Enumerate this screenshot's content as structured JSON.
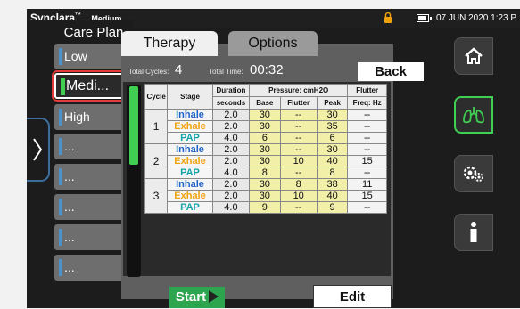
{
  "status": {
    "brand": "Synclara",
    "brand_tm": "™",
    "mode": "Medium",
    "datetime": "07 JUN 2020  1:23 P"
  },
  "care_plan": {
    "title": "Care Plan",
    "items": [
      {
        "label": "Low"
      },
      {
        "label": "Medi..."
      },
      {
        "label": "High"
      },
      {
        "label": "..."
      },
      {
        "label": "..."
      },
      {
        "label": "..."
      },
      {
        "label": "..."
      },
      {
        "label": "..."
      }
    ]
  },
  "tabs": {
    "therapy": "Therapy",
    "options": "Options"
  },
  "summary": {
    "cycles_label": "Total Cycles:",
    "cycles_value": "4",
    "time_label": "Total Time:",
    "time_value": "00:32",
    "back_label": "Back"
  },
  "table": {
    "headers": {
      "cycle": "Cycle",
      "stage": "Stage",
      "duration": "Duration",
      "duration_unit": "seconds",
      "pressure": "Pressure: cmH2O",
      "base": "Base",
      "flutter": "Flutter",
      "peak": "Peak",
      "flutter_col": "Flutter",
      "flutter_unit": "Freq: Hz"
    },
    "cycles": [
      {
        "number": "1",
        "rows": [
          {
            "stage": "Inhale",
            "duration": "2.0",
            "base": "30",
            "flutter": "--",
            "peak": "30",
            "freq": "--"
          },
          {
            "stage": "Exhale",
            "duration": "2.0",
            "base": "30",
            "flutter": "--",
            "peak": "35",
            "freq": "--"
          },
          {
            "stage": "PAP",
            "duration": "4.0",
            "base": "6",
            "flutter": "--",
            "peak": "6",
            "freq": "--"
          }
        ]
      },
      {
        "number": "2",
        "rows": [
          {
            "stage": "Inhale",
            "duration": "2.0",
            "base": "30",
            "flutter": "--",
            "peak": "30",
            "freq": "--"
          },
          {
            "stage": "Exhale",
            "duration": "2.0",
            "base": "30",
            "flutter": "10",
            "peak": "40",
            "freq": "15"
          },
          {
            "stage": "PAP",
            "duration": "4.0",
            "base": "8",
            "flutter": "--",
            "peak": "8",
            "freq": "--"
          }
        ]
      },
      {
        "number": "3",
        "rows": [
          {
            "stage": "Inhale",
            "duration": "2.0",
            "base": "30",
            "flutter": "8",
            "peak": "38",
            "freq": "11"
          },
          {
            "stage": "Exhale",
            "duration": "2.0",
            "base": "30",
            "flutter": "10",
            "peak": "40",
            "freq": "15"
          },
          {
            "stage": "PAP",
            "duration": "4.0",
            "base": "9",
            "flutter": "--",
            "peak": "9",
            "freq": "--"
          }
        ]
      }
    ]
  },
  "actions": {
    "start_label": "Start",
    "edit_label": "Edit"
  },
  "colors": {
    "accent_green": "#3fcf52",
    "inhale": "#1f64c8",
    "exhale": "#f0a20e",
    "pap": "#15a3a8",
    "highlight": "#e53a3a"
  }
}
